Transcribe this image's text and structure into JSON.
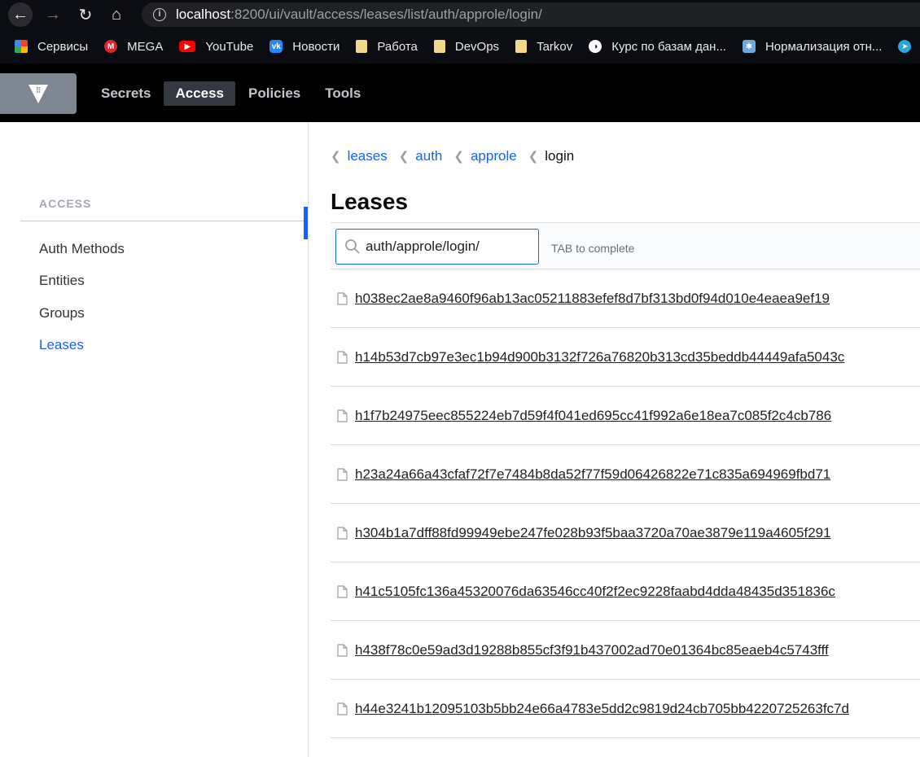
{
  "browser": {
    "url_host": "localhost",
    "url_path": ":8200/ui/vault/access/leases/list/auth/approle/login/"
  },
  "bookmarks": [
    {
      "label": "Сервисы",
      "icon": "apps-grid-icon"
    },
    {
      "label": "MEGA",
      "icon": "mega-icon",
      "glyph": "M"
    },
    {
      "label": "YouTube",
      "icon": "youtube-icon",
      "glyph": "▶"
    },
    {
      "label": "Новости",
      "icon": "vk-icon",
      "glyph": "vk"
    },
    {
      "label": "Работа",
      "icon": "folder-icon"
    },
    {
      "label": "DevOps",
      "icon": "folder-icon"
    },
    {
      "label": "Tarkov",
      "icon": "folder-icon"
    },
    {
      "label": "Курс по базам дан...",
      "icon": "globe-icon",
      "glyph": "◑"
    },
    {
      "label": "Нормализация отн...",
      "icon": "page-icon",
      "glyph": "✱"
    },
    {
      "label": "",
      "icon": "telegram-icon",
      "glyph": "➤"
    }
  ],
  "nav": {
    "items": [
      "Secrets",
      "Access",
      "Policies",
      "Tools"
    ],
    "active": "Access"
  },
  "sidebar": {
    "heading": "ACCESS",
    "items": [
      "Auth Methods",
      "Entities",
      "Groups",
      "Leases"
    ],
    "active": "Leases"
  },
  "breadcrumbs": [
    "leases",
    "auth",
    "approle",
    "login"
  ],
  "page_title": "Leases",
  "search": {
    "value": "auth/approle/login/",
    "hint": "TAB to complete"
  },
  "leases": [
    "h038ec2ae8a9460f96ab13ac05211883efef8d7bf313bd0f94d010e4eaea9ef19",
    "h14b53d7cb97e3ec1b94d900b3132f726a76820b313cd35beddb44449afa5043c",
    "h1f7b24975eec855224eb7d59f4f041ed695cc41f992a6e18ea7c085f2c4cb786",
    "h23a24a66a43cfaf72f7e7484b8da52f77f59d06426822e71c835a694969fbd71",
    "h304b1a7dff88fd99949ebe247fe028b93f5baa3720a70ae3879e119a4605f291",
    "h41c5105fc136a45320076da63546cc40f2f2ec9228faabd4dda48435d351836c",
    "h438f78c0e59ad3d19288b855cf3f91b437002ad70e01364bc85eaeb4c5743fff",
    "h44e3241b12095103b5bb24e66a4783e5dd2c9819d24cb705bb4220725263fc7d"
  ],
  "colors": {
    "accent": "#1563ff",
    "header_bg": "#000000",
    "logo_bg": "#7f8793"
  }
}
